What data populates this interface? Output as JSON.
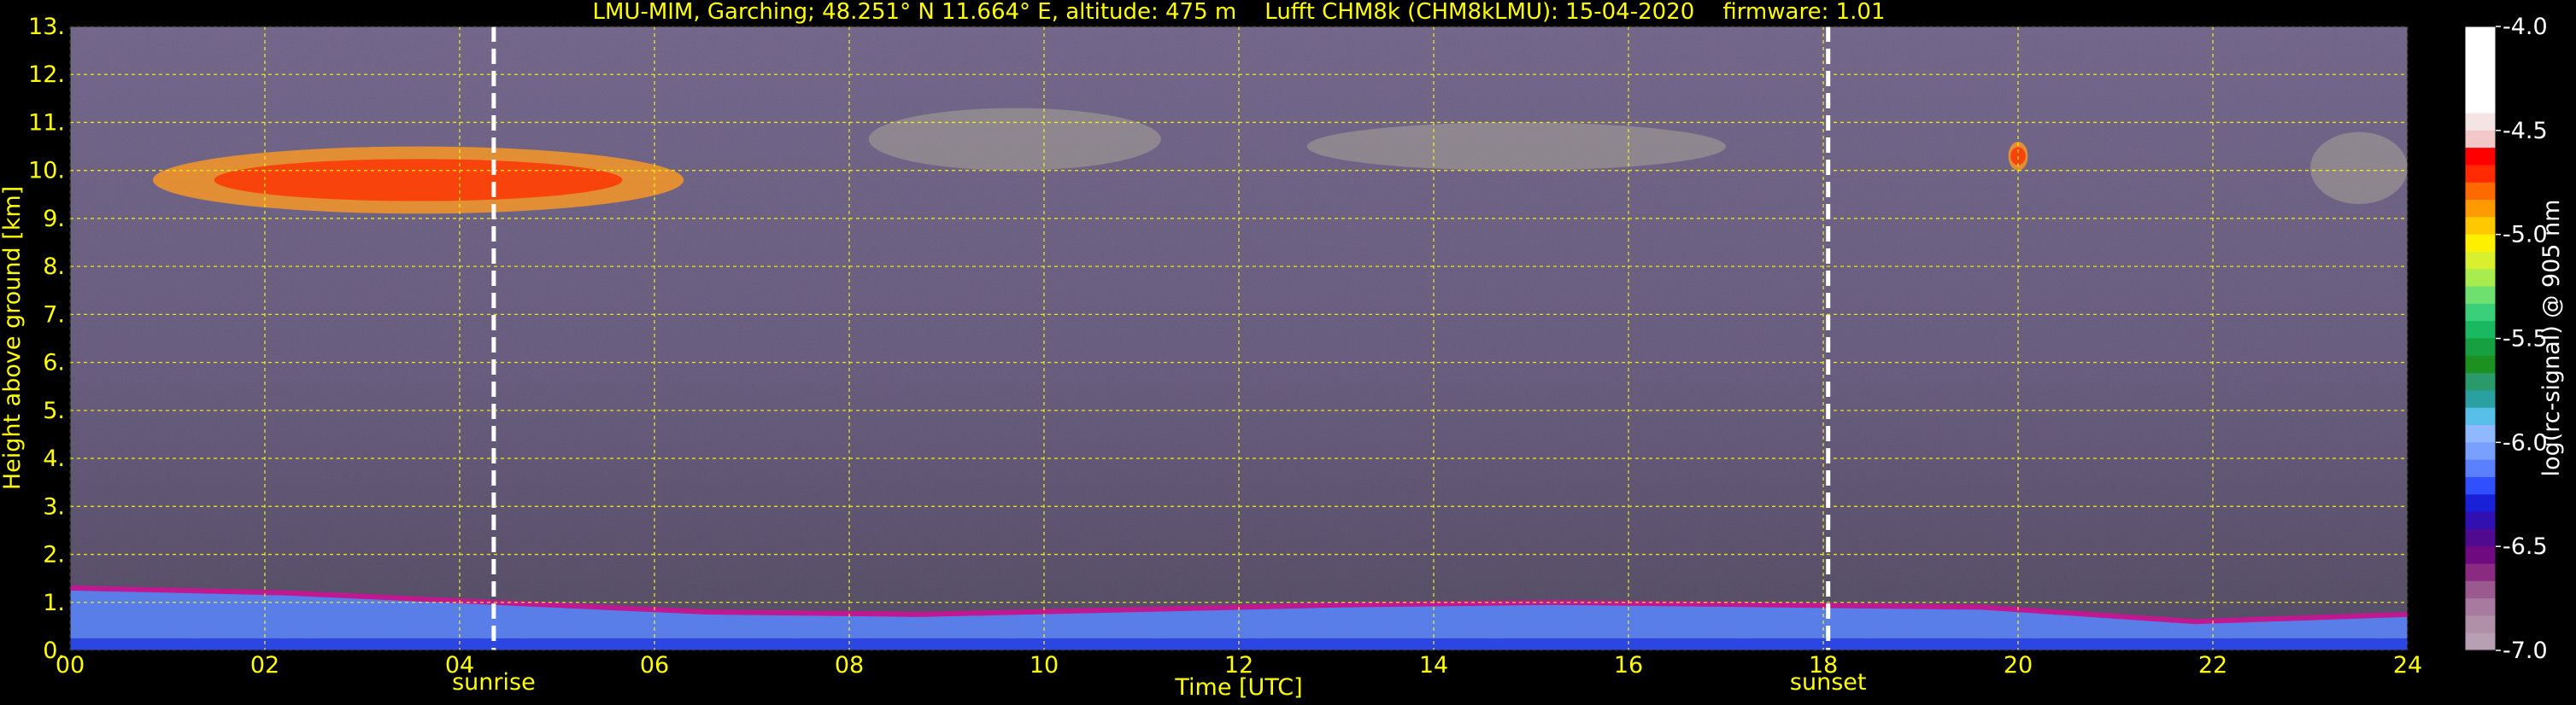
{
  "chart_data": {
    "type": "heatmap",
    "title": "LMU-MIM, Garching; 48.251° N 11.664° E, altitude: 475 m    Lufft CHM8k (CHM8kLMU): 15-04-2020    firmware: 1.01",
    "xlabel": "Time [UTC]",
    "ylabel": "Height above ground [km]",
    "xlim": [
      0,
      24
    ],
    "ylim": [
      0,
      13
    ],
    "x_ticks": [
      "00",
      "02",
      "04",
      "06",
      "08",
      "10",
      "12",
      "14",
      "16",
      "18",
      "20",
      "22",
      "24"
    ],
    "y_ticks": [
      "0.",
      "1.",
      "2.",
      "3.",
      "4.",
      "5.",
      "6.",
      "7.",
      "8.",
      "9.",
      "10.",
      "11.",
      "12.",
      "13."
    ],
    "grid": true,
    "grid_color": "#ffff00",
    "text_color": "#ffff00",
    "markers": [
      {
        "label": "sunrise",
        "time": 4.35
      },
      {
        "label": "sunset",
        "time": 18.05
      }
    ],
    "colorbar": {
      "label": "log(rc-signal) @ 905 nm",
      "range": [
        -7.0,
        -4.0
      ],
      "ticks": [
        "-4.0",
        "-4.5",
        "-5.0",
        "-5.5",
        "-6.0",
        "-6.5",
        "-7.0"
      ],
      "colors": [
        "#ffffff",
        "#ffffff",
        "#ffffff",
        "#ffffff",
        "#ffffff",
        "#f4e4e4",
        "#f2c8c8",
        "#ff0000",
        "#ff2a00",
        "#ff6a00",
        "#ff9a00",
        "#ffc800",
        "#fff000",
        "#d8f030",
        "#a8ec50",
        "#6ee070",
        "#3ad07a",
        "#1ab860",
        "#16a040",
        "#1c9020",
        "#2a9a6a",
        "#2aa0a0",
        "#58c0e8",
        "#90b8ff",
        "#7aa0ff",
        "#5a80ff",
        "#3050ff",
        "#1820d8",
        "#3010b0",
        "#500a90",
        "#700a80",
        "#8a2a80",
        "#9a5a90",
        "#a87aa0",
        "#b090a8",
        "#b8a0b4"
      ]
    },
    "regions": [
      {
        "kind": "boundary-layer",
        "t_start": 0,
        "t_end": 24,
        "top_km": [
          1.3,
          1.2,
          1.0,
          0.8,
          0.75,
          0.85,
          0.95,
          1.0,
          0.95,
          0.9,
          0.6,
          0.75
        ]
      },
      {
        "kind": "cirrus",
        "t_start": 0.85,
        "t_end": 6.3,
        "base_km": 9.1,
        "top_km": 10.5,
        "intensity": "high"
      },
      {
        "kind": "cirrus",
        "t_start": 8.2,
        "t_end": 11.2,
        "base_km": 10.0,
        "top_km": 11.3,
        "intensity": "low"
      },
      {
        "kind": "cirrus",
        "t_start": 12.7,
        "t_end": 17.0,
        "base_km": 10.0,
        "top_km": 11.0,
        "intensity": "low"
      },
      {
        "kind": "cirrus",
        "t_start": 19.9,
        "t_end": 20.1,
        "base_km": 10.0,
        "top_km": 10.6,
        "intensity": "high"
      },
      {
        "kind": "cirrus",
        "t_start": 23.0,
        "t_end": 24.0,
        "base_km": 9.3,
        "top_km": 10.8,
        "intensity": "low"
      }
    ]
  }
}
